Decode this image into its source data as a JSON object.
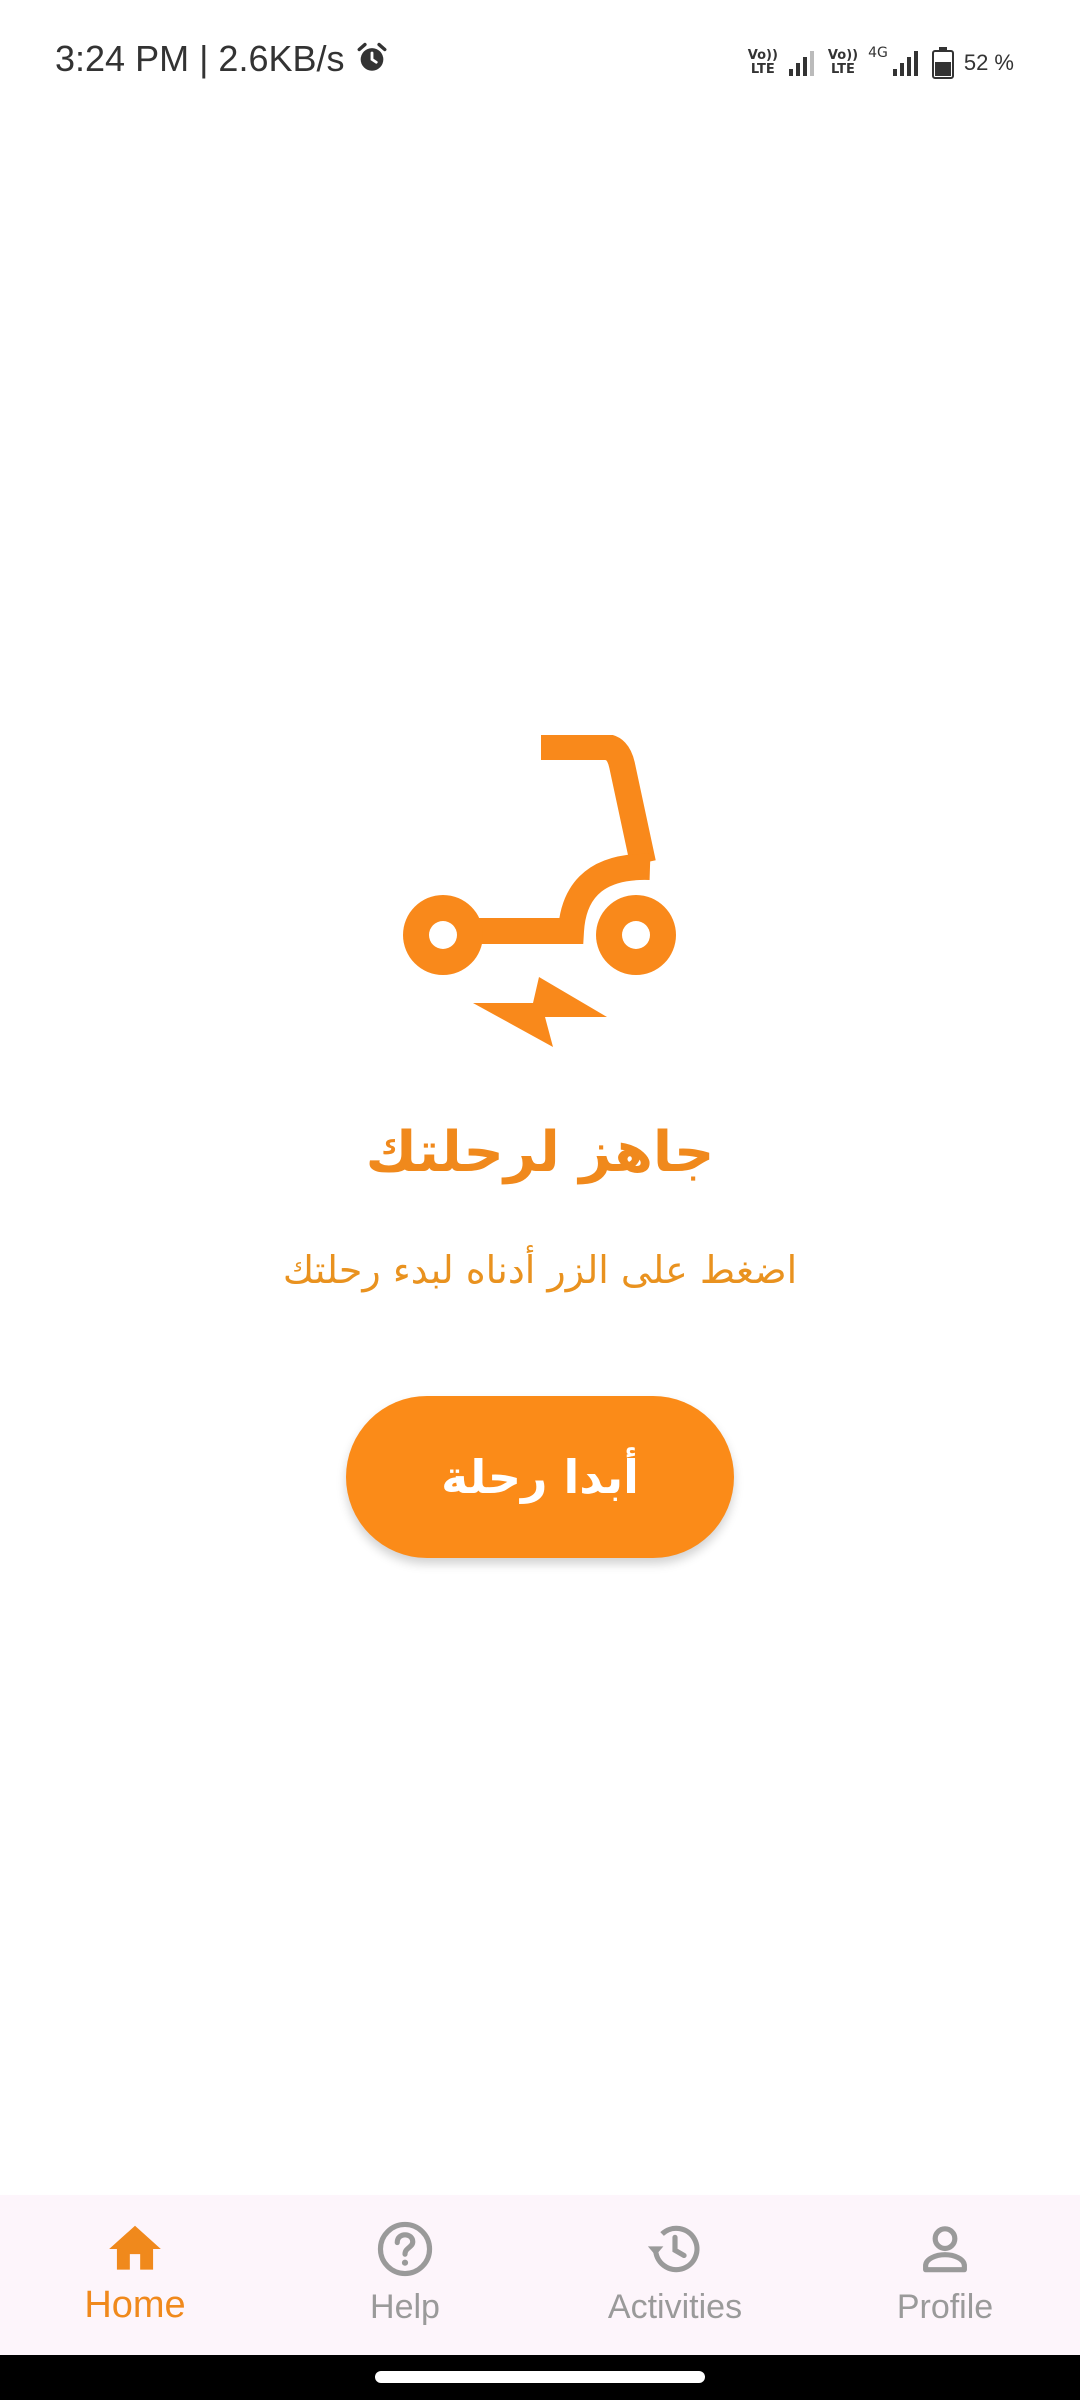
{
  "status_bar": {
    "time_speed": "3:24 PM | 2.6KB/s",
    "alarm_icon": "alarm-icon",
    "volte_top": "Vo))",
    "volte_bottom": "LTE",
    "network_type": "4G",
    "battery_percent": "52 %"
  },
  "main": {
    "icon": "electric-scooter-icon",
    "title": "جاهز لرحلتك",
    "subtitle": "اضغط على الزر أدناه لبدء رحلتك",
    "start_button_label": "أبدا رحلة"
  },
  "bottom_nav": {
    "items": [
      {
        "label": "Home",
        "icon": "home-icon",
        "active": true
      },
      {
        "label": "Help",
        "icon": "help-icon",
        "active": false
      },
      {
        "label": "Activities",
        "icon": "history-icon",
        "active": false
      },
      {
        "label": "Profile",
        "icon": "profile-icon",
        "active": false
      }
    ]
  },
  "colors": {
    "accent": "#f0891c",
    "button": "#fb8b18",
    "nav_background": "#fdf5fb",
    "nav_inactive": "#9a9a9a"
  }
}
